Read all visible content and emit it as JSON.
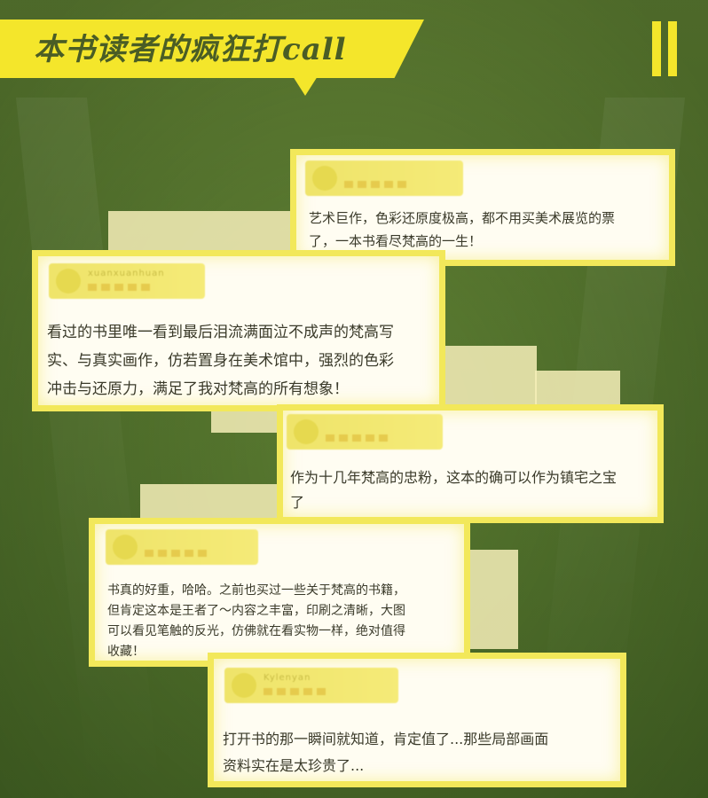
{
  "header": {
    "title": "本书读者的疯狂打call",
    "accent_color": "#f4e62b",
    "text_color": "#4a5d25"
  },
  "icons": {
    "bars": "double-vertical-bars-icon",
    "avatar": "avatar-icon",
    "stars": "star-rating-icon"
  },
  "reviews": [
    {
      "username": "",
      "lines": [
        "艺术巨作，色彩还原度极高，都不用买美术展览的票",
        "了，一本书看尽梵高的一生！"
      ]
    },
    {
      "username": "xuanxuanhuan",
      "lines": [
        "看过的书里唯一看到最后泪流满面泣不成声的梵高写",
        "实、与真实画作，仿若置身在美术馆中，强烈的色彩",
        "冲击与还原力，满足了我对梵高的所有想象！"
      ]
    },
    {
      "username": "",
      "lines": [
        "作为十几年梵高的忠粉，这本的确可以作为镇宅之宝",
        "了"
      ]
    },
    {
      "username": "",
      "lines": [
        "书真的好重，哈哈。之前也买过一些关于梵高的书籍，",
        "但肯定这本是王者了～内容之丰富，印刷之清晰，大图",
        "可以看见笔触的反光，仿佛就在看实物一样，绝对值得",
        "收藏！"
      ]
    },
    {
      "username": "Kylenyan",
      "lines": [
        "打开书的那一瞬间就知道，肯定值了...那些局部画面",
        "资料实在是太珍贵了..."
      ]
    }
  ]
}
